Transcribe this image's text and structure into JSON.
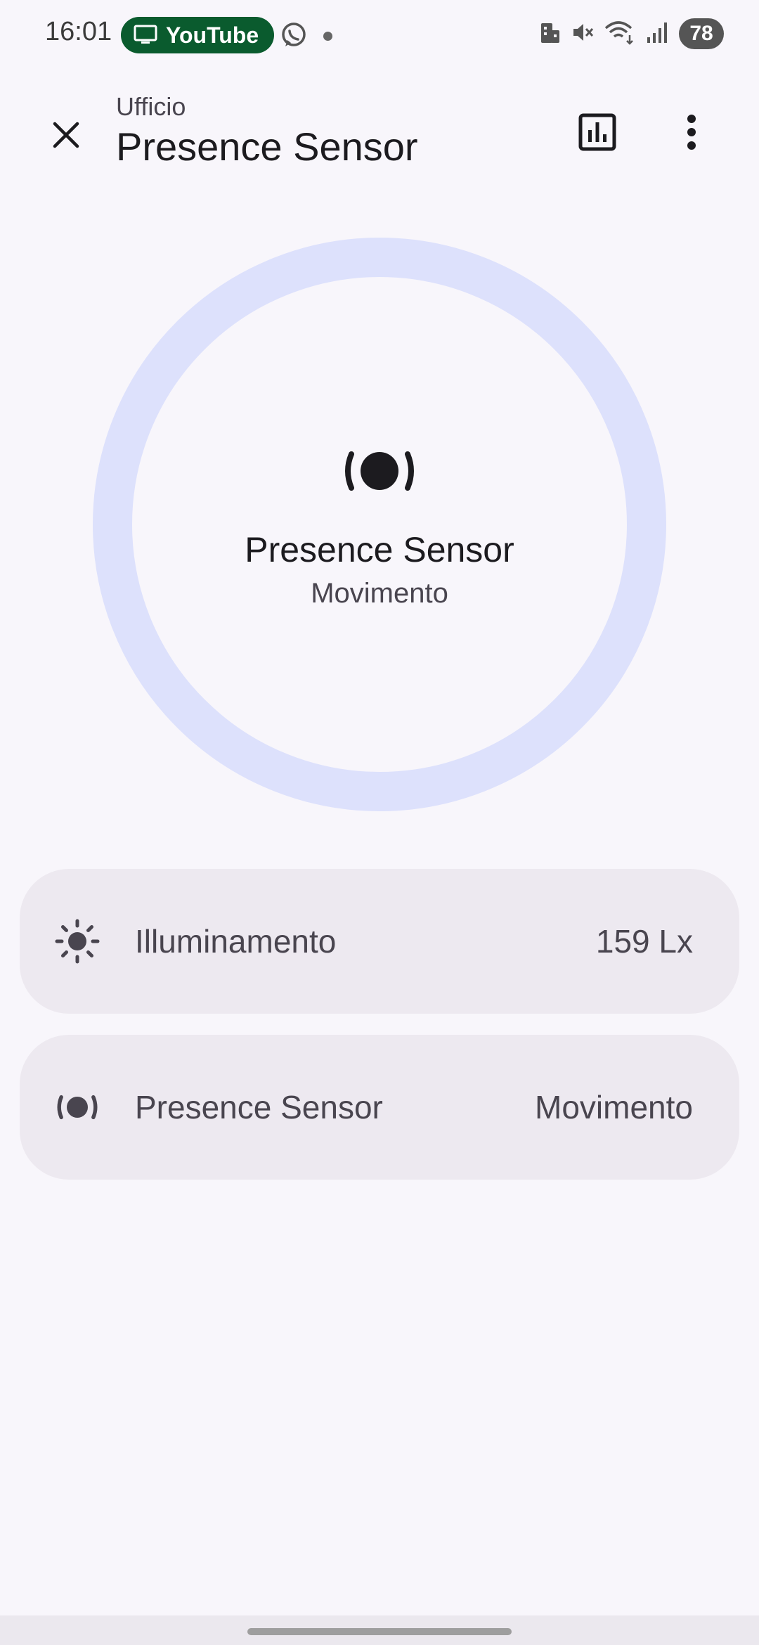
{
  "status_bar": {
    "time": "16:01",
    "cast_pill_label": "YouTube",
    "battery": "78",
    "colors": {
      "pill_background": "#0a5b2e"
    },
    "icons": [
      "screen-icon",
      "whatsapp-icon",
      "notification-dot-icon",
      "building-icon",
      "mute-icon",
      "wifi-icon",
      "signal-icon",
      "battery-icon"
    ]
  },
  "header": {
    "subtitle": "Ufficio",
    "title": "Presence Sensor",
    "icons": [
      "close-icon",
      "history-chart-icon",
      "more-vert-icon"
    ]
  },
  "main_state": {
    "icon": "motion-sensor-icon",
    "name": "Presence Sensor",
    "state": "Movimento",
    "ring_color": "#dde1fc"
  },
  "entities": [
    {
      "icon": "brightness-icon",
      "label": "Illuminamento",
      "value": "159 Lx"
    },
    {
      "icon": "motion-sensor-icon",
      "label": "Presence Sensor",
      "value": "Movimento"
    }
  ],
  "colors": {
    "background": "#f8f6fb",
    "card_background": "#ede9f0",
    "text_primary": "#1c1b1f",
    "text_secondary": "#49454f"
  }
}
